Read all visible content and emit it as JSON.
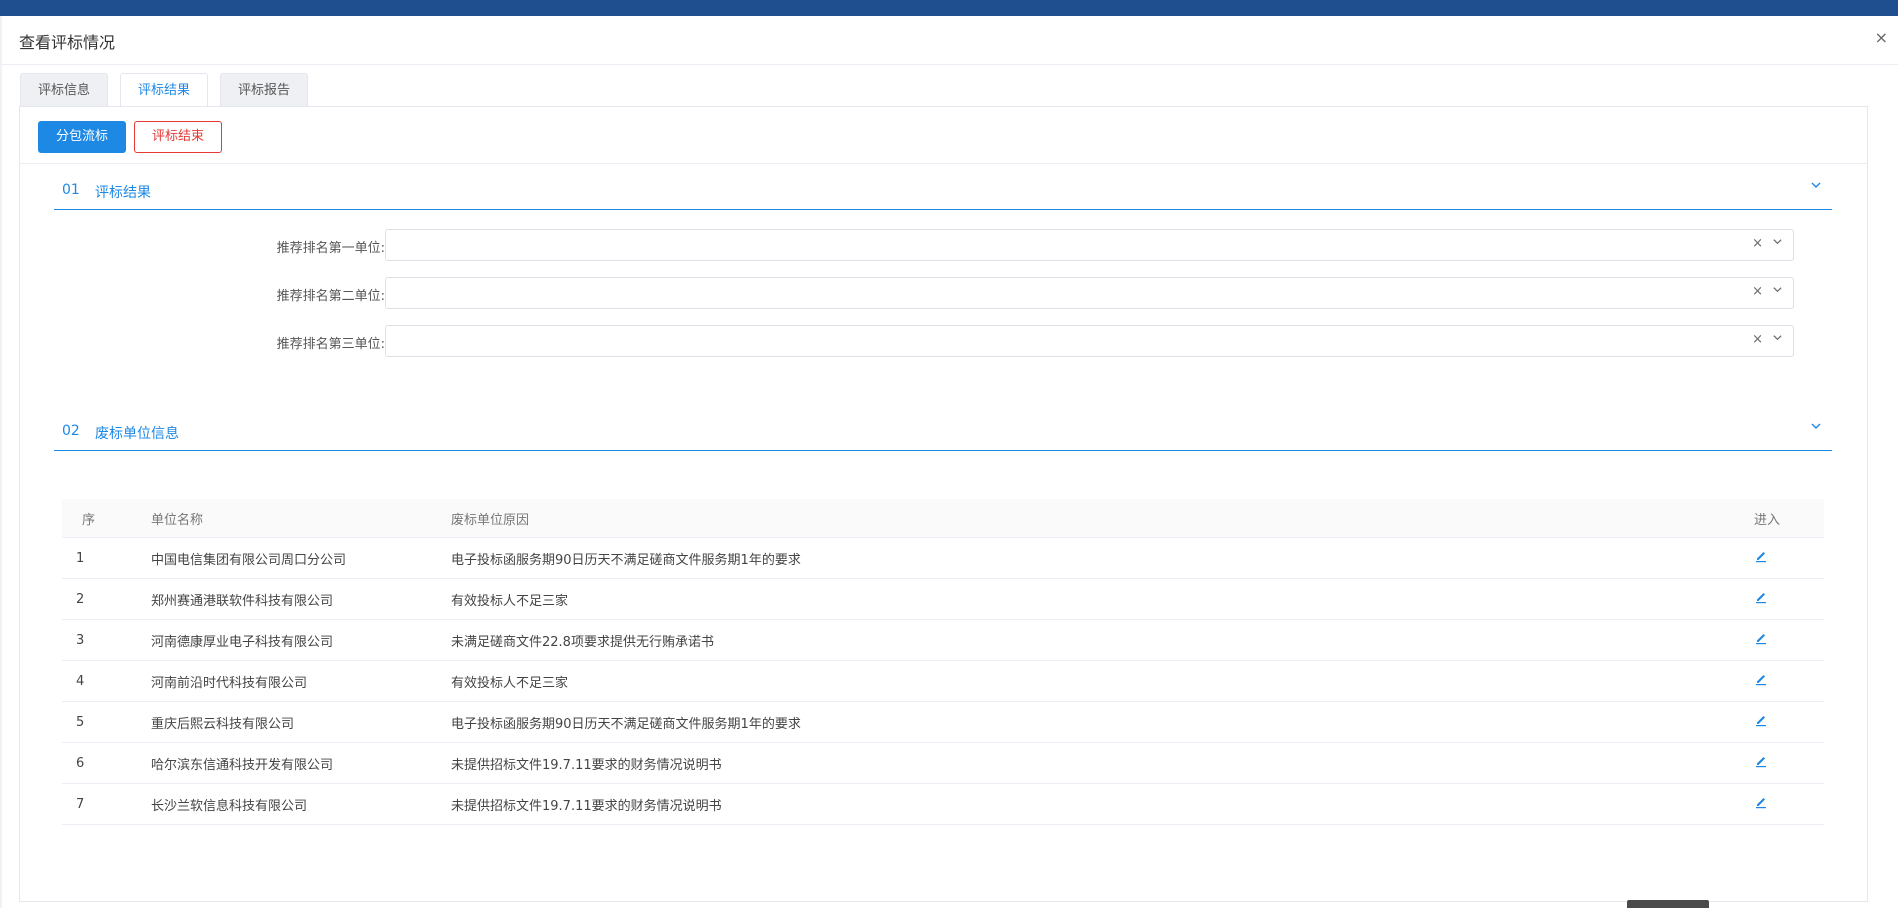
{
  "dialog": {
    "title": "查看评标情况",
    "close": "×"
  },
  "tabs": [
    {
      "label": "评标信息",
      "active": false
    },
    {
      "label": "评标结果",
      "active": true
    },
    {
      "label": "评标报告",
      "active": false
    }
  ],
  "toolbar": {
    "split_label": "分包流标",
    "end_label": "评标结束"
  },
  "section1": {
    "num": "01",
    "title": "评标结果",
    "chevron": "chevron-down-icon"
  },
  "form": {
    "rows": [
      {
        "label": "推荐排名第一单位:",
        "value": ""
      },
      {
        "label": "推荐排名第二单位:",
        "value": ""
      },
      {
        "label": "推荐排名第三单位:",
        "value": ""
      }
    ],
    "clear_glyph": "×",
    "arrow_glyph": "⌄"
  },
  "section2": {
    "num": "02",
    "title": "废标单位信息",
    "chevron": "chevron-down-icon"
  },
  "table": {
    "headers": {
      "seq": "序",
      "name": "单位名称",
      "reason": "废标单位原因",
      "enter": "进入"
    },
    "rows": [
      {
        "seq": "1",
        "name": "中国电信集团有限公司周口分公司",
        "reason": "电子投标函服务期90日历天不满足磋商文件服务期1年的要求"
      },
      {
        "seq": "2",
        "name": "郑州赛通港联软件科技有限公司",
        "reason": "有效投标人不足三家"
      },
      {
        "seq": "3",
        "name": "河南德康厚业电子科技有限公司",
        "reason": "未满足磋商文件22.8项要求提供无行贿承诺书"
      },
      {
        "seq": "4",
        "name": "河南前沿时代科技有限公司",
        "reason": "有效投标人不足三家"
      },
      {
        "seq": "5",
        "name": "重庆后熙云科技有限公司",
        "reason": "电子投标函服务期90日历天不满足磋商文件服务期1年的要求"
      },
      {
        "seq": "6",
        "name": "哈尔滨东信通科技开发有限公司",
        "reason": "未提供招标文件19.7.11要求的财务情况说明书"
      },
      {
        "seq": "7",
        "name": "长沙兰软信息科技有限公司",
        "reason": "未提供招标文件19.7.11要求的财务情况说明书"
      }
    ]
  },
  "colors": {
    "accent": "#1e88e5",
    "danger": "#e53935",
    "topbar": "#1f4f8f"
  }
}
